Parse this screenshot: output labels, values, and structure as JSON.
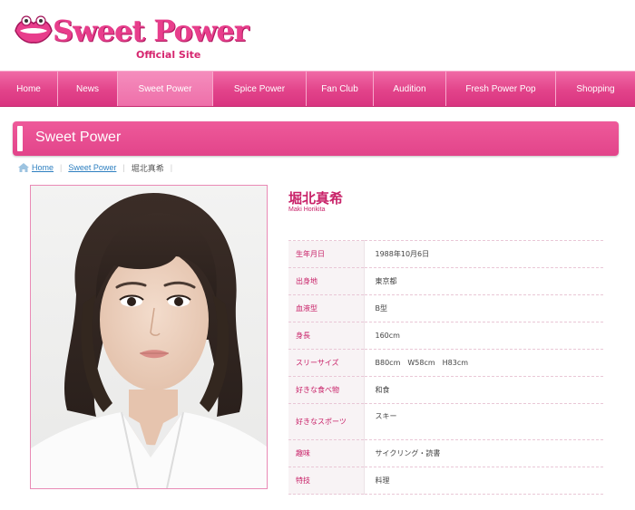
{
  "header": {
    "logo_text": "Sweet Power",
    "logo_sub": "Official Site",
    "brand_color": "#e83e8c"
  },
  "nav": {
    "items": [
      {
        "label": "Home"
      },
      {
        "label": "News"
      },
      {
        "label": "Sweet Power",
        "active": true
      },
      {
        "label": "Spice Power"
      },
      {
        "label": "Fan Club"
      },
      {
        "label": "Audition"
      },
      {
        "label": "Fresh Power Pop"
      },
      {
        "label": "Shopping"
      }
    ]
  },
  "section": {
    "title": "Sweet Power"
  },
  "breadcrumb": {
    "home": "Home",
    "section": "Sweet Power",
    "current": "堀北真希"
  },
  "profile": {
    "name_ja": "堀北真希",
    "name_en": "Maki Horikita",
    "rows": [
      {
        "label": "生年月日",
        "value": "1988年10月6日"
      },
      {
        "label": "出身地",
        "value": "東京都"
      },
      {
        "label": "血液型",
        "value": "B型"
      },
      {
        "label": "身長",
        "value": "160cm"
      },
      {
        "label": "スリーサイズ",
        "value": "B80cm　W58cm　H83cm"
      },
      {
        "label": "好きな食べ物",
        "value": "和食"
      },
      {
        "label": "好きなスポーツ",
        "value": "スキー"
      },
      {
        "label": "趣味",
        "value": "サイクリング・読書"
      },
      {
        "label": "特技",
        "value": "料理"
      }
    ]
  }
}
